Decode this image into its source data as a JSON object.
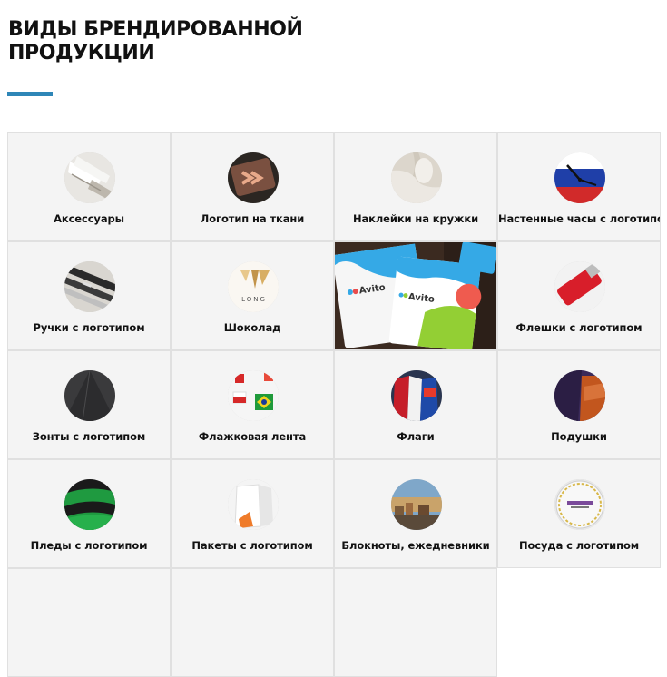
{
  "page": {
    "title_line1": "ВИДЫ БРЕНДИРОВАННОЙ",
    "title_line2": "ПРОДУКЦИИ",
    "accent_color": "#2e86b7"
  },
  "products": [
    {
      "label": "Аксессуары",
      "icon": "accessories-icon"
    },
    {
      "label": "Логотип на ткани",
      "icon": "fabric-logo-icon"
    },
    {
      "label": "Наклейки на кружки",
      "icon": "mug-sticker-icon"
    },
    {
      "label": "Настенные часы с логотипом",
      "icon": "wall-clock-icon"
    },
    {
      "label": "Ручки с логотипом",
      "icon": "pen-icon"
    },
    {
      "label": "Шоколад",
      "icon": "chocolate-icon",
      "logo_text": "LONG"
    },
    {
      "label": "",
      "icon": "avito-cards-photo",
      "photo_text": "Avito"
    },
    {
      "label": "Флешки с логотипом",
      "icon": "usb-flash-icon"
    },
    {
      "label": "Зонты с логотипом",
      "icon": "umbrella-icon"
    },
    {
      "label": "Флажковая лента",
      "icon": "flag-ribbon-icon"
    },
    {
      "label": "Флаги",
      "icon": "flags-icon"
    },
    {
      "label": "Подушки",
      "icon": "pillow-icon"
    },
    {
      "label": "Пледы с логотипом",
      "icon": "blanket-icon"
    },
    {
      "label": "Пакеты с логотипом",
      "icon": "bag-icon"
    },
    {
      "label": "Блокноты, ежедневники",
      "icon": "notebook-icon"
    },
    {
      "label": "Посуда с логотипом",
      "icon": "tableware-icon"
    }
  ]
}
